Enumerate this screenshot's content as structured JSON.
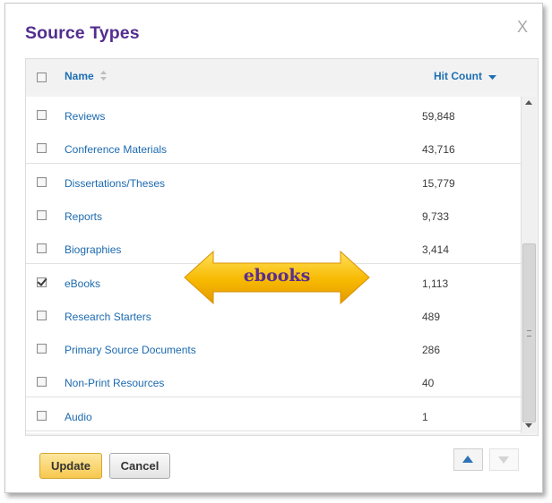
{
  "dialog": {
    "title": "Source Types",
    "close_label": "X"
  },
  "table": {
    "col_name": "Name",
    "col_hit": "Hit Count",
    "sort_name_icon": "sort-both-icon",
    "sort_hit_icon": "caret-down-icon",
    "rows": [
      {
        "name": "Reviews",
        "count": "59,848",
        "checked": false
      },
      {
        "name": "Conference Materials",
        "count": "43,716",
        "checked": false
      },
      {
        "name": "Dissertations/Theses",
        "count": "15,779",
        "checked": false
      },
      {
        "name": "Reports",
        "count": "9,733",
        "checked": false
      },
      {
        "name": "Biographies",
        "count": "3,414",
        "checked": false
      },
      {
        "name": "eBooks",
        "count": "1,113",
        "checked": true
      },
      {
        "name": "Research Starters",
        "count": "489",
        "checked": false
      },
      {
        "name": "Primary Source Documents",
        "count": "286",
        "checked": false
      },
      {
        "name": "Non-Print Resources",
        "count": "40",
        "checked": false
      },
      {
        "name": "Audio",
        "count": "1",
        "checked": false
      }
    ]
  },
  "buttons": {
    "update": "Update",
    "cancel": "Cancel"
  },
  "annotation": {
    "label": "ebooks",
    "arrow_color": "#f5b800",
    "label_color": "#5a2d8e"
  },
  "colors": {
    "title": "#532e8f",
    "link": "#1c6aaf",
    "update_button": "#f7c84e"
  }
}
